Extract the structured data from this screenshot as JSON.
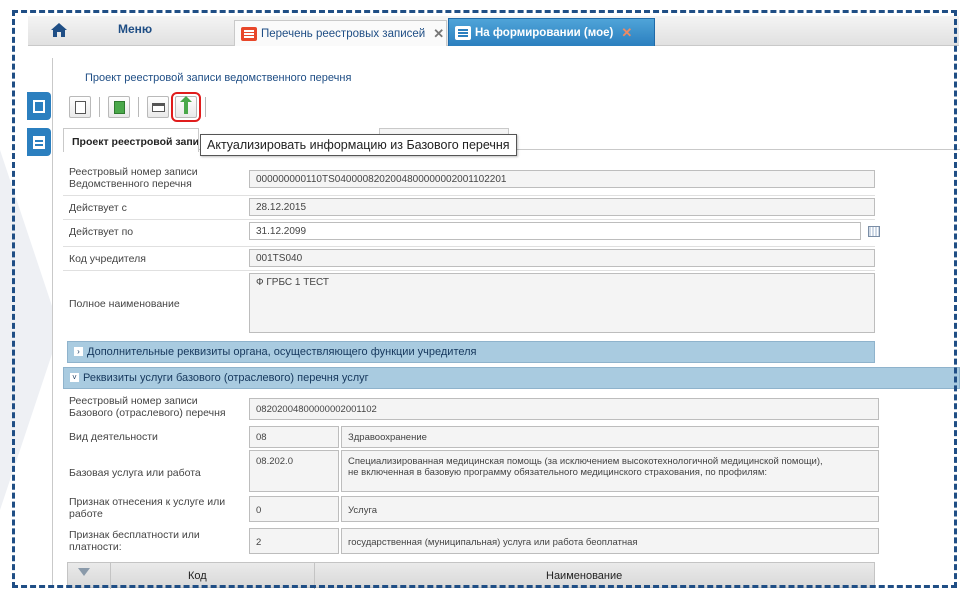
{
  "topbar": {
    "menu_label": "Меню",
    "tabs": [
      {
        "label": "Перечень реестровых записей",
        "close": "✕"
      },
      {
        "label": "На формировании (мое)",
        "close": "✕"
      }
    ]
  },
  "panel": {
    "title": "Проект реестровой записи ведомственного перечня",
    "tooltip": "Актуализировать информацию из Базового перечня",
    "inner_tabs": [
      "Проект реестровой записи",
      ""
    ]
  },
  "form": {
    "registry_number": {
      "label_1": "Реестровый номер записи",
      "label_2": "Ведомственного перечня",
      "value": "000000000110TS0400008202004800000002001102201"
    },
    "valid_from": {
      "label": "Действует с",
      "value": "28.12.2015"
    },
    "valid_to": {
      "label": "Действует по",
      "value": "31.12.2099"
    },
    "founder_code": {
      "label": "Код учредителя",
      "value": "001TS040"
    },
    "full_name": {
      "label": "Полное наименование",
      "value": "Ф ГРБС 1 ТЕСТ"
    }
  },
  "sections": {
    "extra": {
      "label": "Дополнительные реквизиты органа, осуществляющего функции учредителя",
      "chevron": "›"
    },
    "service": {
      "label": "Реквизиты услуги базового (отраслевого) перечня услуг",
      "chevron": "˅"
    }
  },
  "service": {
    "base_number": {
      "label_1": "Реестровый номер записи",
      "label_2": "Базового (отраслевого) перечня",
      "value": "08202004800000002001102"
    },
    "activity": {
      "label": "Вид деятельности",
      "code": "08",
      "name": "Здравоохранение"
    },
    "base_service": {
      "label": "Базовая услуга или работа",
      "code": "08.202.0",
      "name_1": "Специализированная медицинская помощь (за исключением высокотехнологичной медицинской помощи),",
      "name_2": "не включенная в базовую программу обязательного медицинского страхования, по профилям:"
    },
    "service_sign": {
      "label_1": "Признак отнесения к услуге или",
      "label_2": "работе",
      "code": "0",
      "name": "Услуга"
    },
    "free_sign": {
      "label_1": "Признак бесплатности или",
      "label_2": "платности:",
      "code": "2",
      "name": "государственная (муниципальная) услуга или работа беоплатная"
    }
  },
  "grid": {
    "col_code": "Код",
    "col_name": "Наименование"
  },
  "colors": {
    "accent": "#2b7fbf",
    "section_bar": "#a9cbe0",
    "highlight": "#e01c1c"
  }
}
